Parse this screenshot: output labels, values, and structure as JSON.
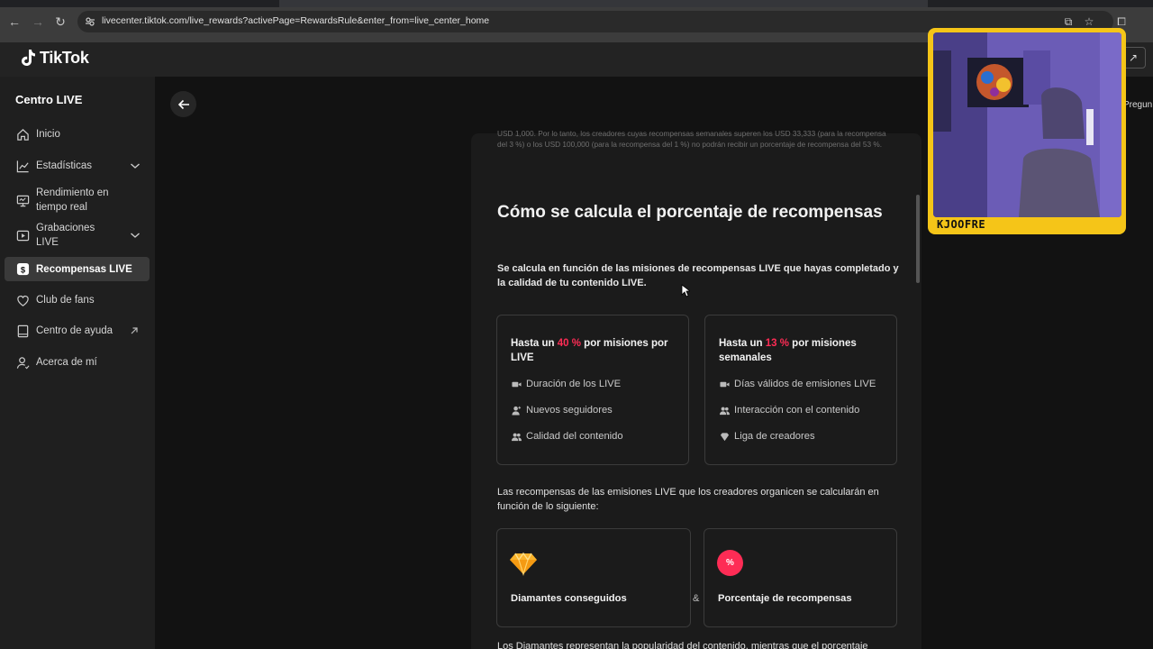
{
  "browser": {
    "url": "livecenter.tiktok.com/live_rewards?activePage=RewardsRule&enter_from=live_center_home"
  },
  "header": {
    "logo_text": "TikTok",
    "right_text": "Pregun"
  },
  "sidebar": {
    "title": "Centro LIVE",
    "items": [
      {
        "label": "Inicio",
        "icon": "home-icon"
      },
      {
        "label": "Estadísticas",
        "icon": "chart-icon",
        "expandable": true
      },
      {
        "label": "Rendimiento en tiempo real",
        "icon": "monitor-icon"
      },
      {
        "label": "Grabaciones LIVE",
        "icon": "play-icon",
        "expandable": true
      },
      {
        "label": "Recompensas LIVE",
        "icon": "dollar-icon",
        "active": true
      },
      {
        "label": "Club de fans",
        "icon": "heart-icon"
      },
      {
        "label": "Centro de ayuda",
        "icon": "book-icon",
        "external": true
      },
      {
        "label": "Acerca de mí",
        "icon": "user-icon"
      }
    ]
  },
  "content": {
    "fineprint": "USD 1,000. Por lo tanto, los creadores cuyas recompensas semanales superen los USD 33,333 (para la recompensa del 3 %) o los USD 100,000 (para la recompensa del 1 %) no podrán recibir un porcentaje de recompensa del 53 %.",
    "heading": "Cómo se calcula el porcentaje de recompensas",
    "intro": "Se calcula en función de las misiones de recompensas LIVE que hayas completado y la calidad de tu contenido LIVE.",
    "card_left": {
      "title_prefix": "Hasta un ",
      "title_highlight": "40 %",
      "title_suffix": " por misiones por LIVE",
      "rows": [
        "Duración de los LIVE",
        "Nuevos seguidores",
        "Calidad del contenido"
      ]
    },
    "card_right": {
      "title_prefix": "Hasta un ",
      "title_highlight": "13 %",
      "title_suffix": " por misiones semanales",
      "rows": [
        "Días válidos de emisiones LIVE",
        "Interacción con el contenido",
        "Liga de creadores"
      ]
    },
    "para2": "Las recompensas de las emisiones LIVE que los creadores organicen se calcularán en función de lo siguiente:",
    "factor_left": "Diamantes conseguidos",
    "ampersand": "&",
    "factor_right": "Porcentaje de recompensas",
    "factor_right_badge": "%",
    "bottom_cut": "Los Diamantes representan la popularidad del contenido, mientras que el porcentaje"
  },
  "webcam": {
    "name": "KJOOFRE"
  },
  "colors": {
    "accent": "#fe2c55",
    "cam_frame": "#f5c518"
  }
}
